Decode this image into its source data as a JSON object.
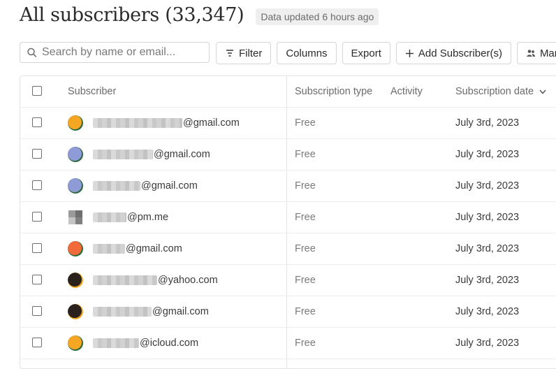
{
  "header": {
    "title": "All subscribers (33,347)",
    "updated_badge": "Data updated 6 hours ago"
  },
  "toolbar": {
    "search_placeholder": "Search by name or email...",
    "filter_label": "Filter",
    "columns_label": "Columns",
    "export_label": "Export",
    "add_label": "Add Subscriber(s)",
    "manage_label": "Man"
  },
  "table": {
    "columns": {
      "subscriber": "Subscriber",
      "type": "Subscription type",
      "activity": "Activity",
      "date": "Subscription date"
    },
    "rows": [
      {
        "domain": "@gmail.com",
        "type": "Free",
        "date": "July 3rd, 2023",
        "avatar": [
          "#f5a623",
          "#2d6a3e"
        ]
      },
      {
        "domain": "@gmail.com",
        "type": "Free",
        "date": "July 3rd, 2023",
        "avatar": [
          "#8f9bd6",
          "#2d6a3e"
        ]
      },
      {
        "domain": "@gmail.com",
        "type": "Free",
        "date": "July 3rd, 2023",
        "avatar": [
          "#8f9bd6",
          "#2d6a3e"
        ]
      },
      {
        "domain": "@pm.me",
        "type": "Free",
        "date": "July 3rd, 2023",
        "avatar": [
          "pixel",
          "pixel"
        ]
      },
      {
        "domain": "@gmail.com",
        "type": "Free",
        "date": "July 3rd, 2023",
        "avatar": [
          "#f06a3a",
          "#2d6a3e"
        ]
      },
      {
        "domain": "@yahoo.com",
        "type": "Free",
        "date": "July 3rd, 2023",
        "avatar": [
          "#2a211c",
          "#f5a623"
        ]
      },
      {
        "domain": "@gmail.com",
        "type": "Free",
        "date": "July 3rd, 2023",
        "avatar": [
          "#2a211c",
          "#f5a623"
        ]
      },
      {
        "domain": "@icloud.com",
        "type": "Free",
        "date": "July 3rd, 2023",
        "avatar": [
          "#f5a623",
          "#2d6a3e"
        ]
      }
    ]
  }
}
